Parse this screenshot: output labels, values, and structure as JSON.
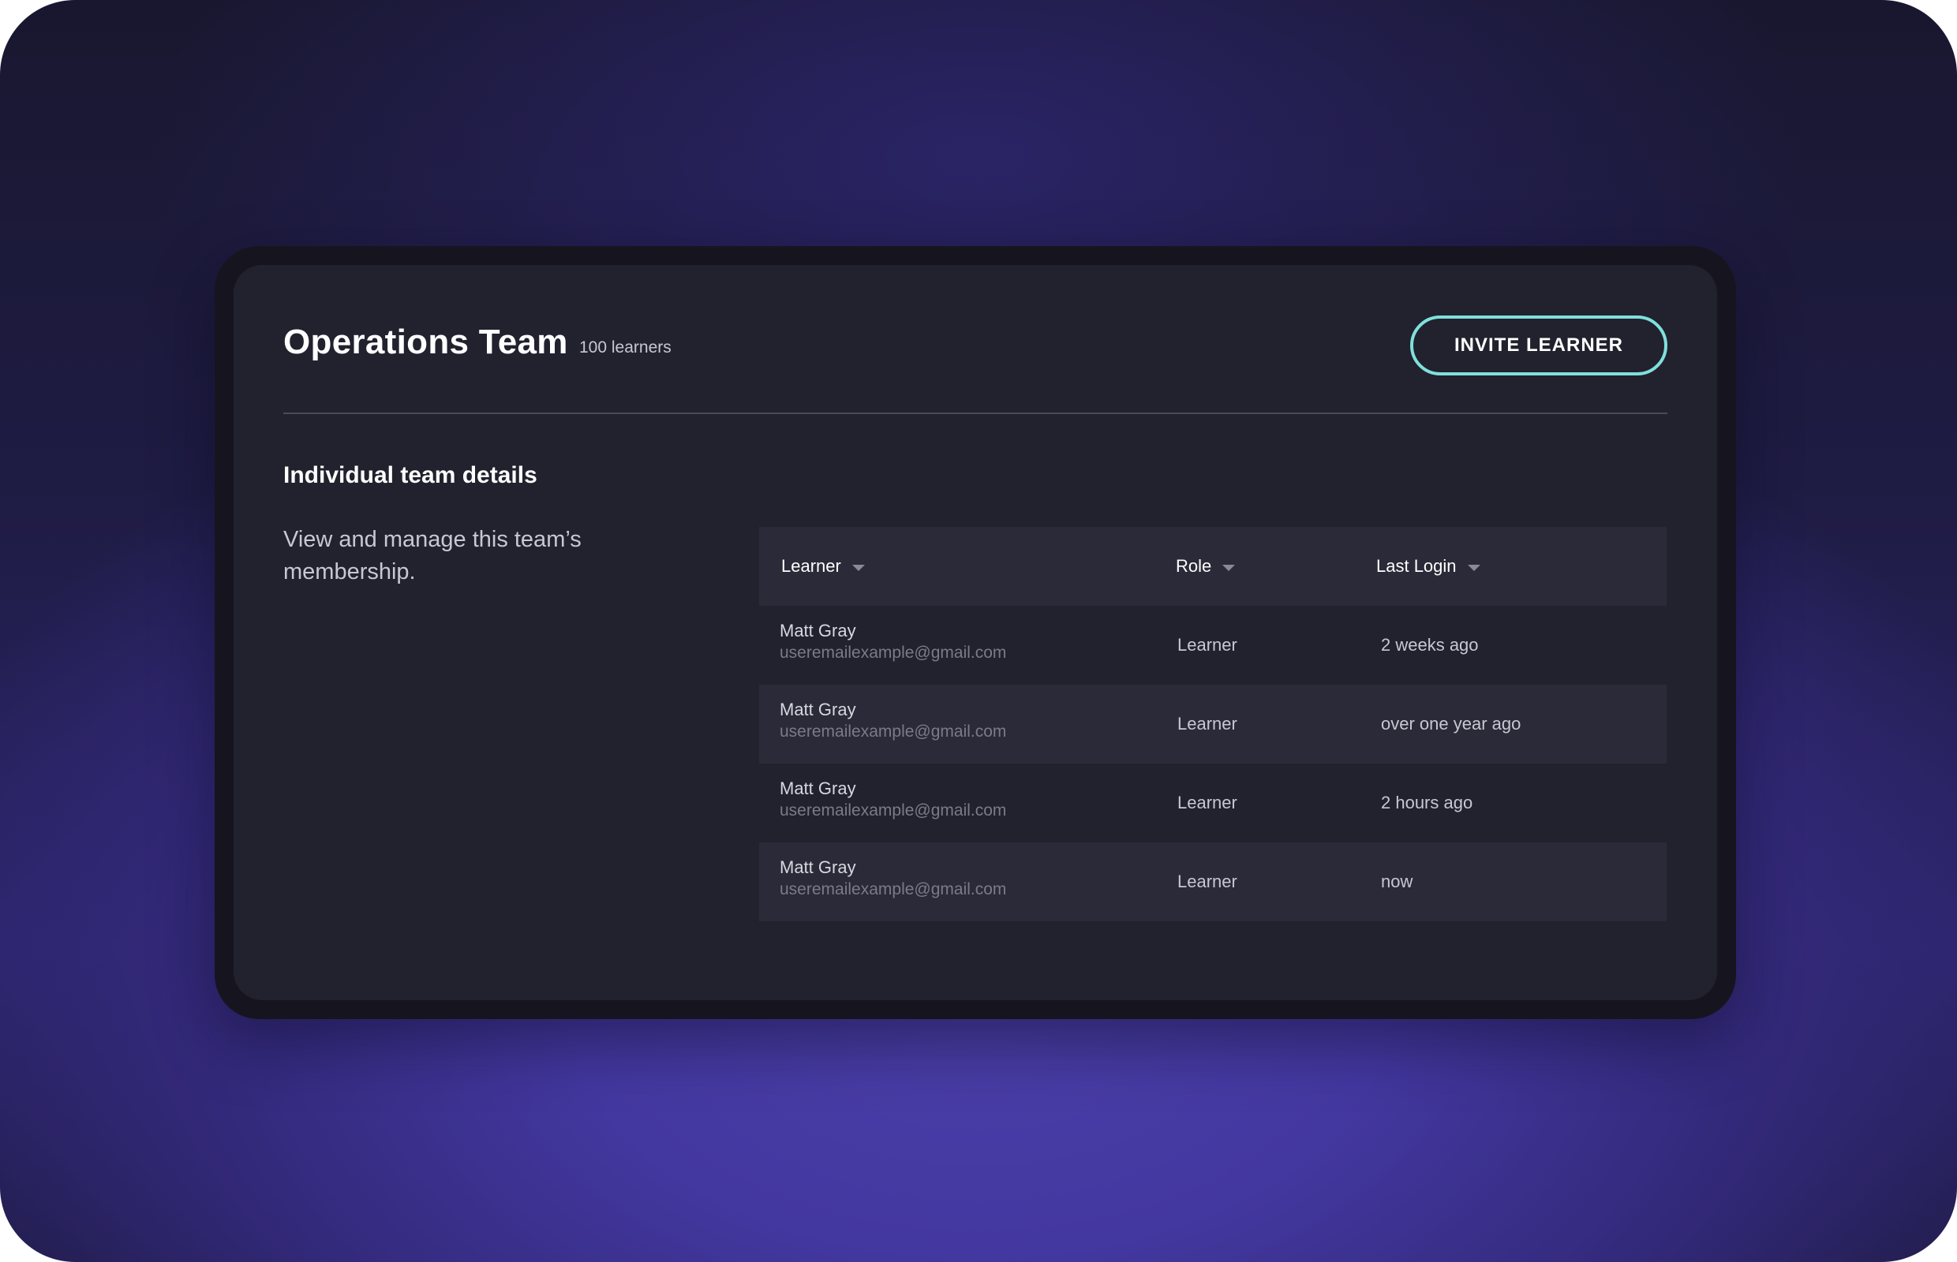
{
  "team": {
    "title": "Operations Team",
    "count": "100 learners",
    "invite_label": "INVITE LEARNER"
  },
  "section": {
    "title": "Individual team details",
    "description": "View and manage this team’s membership."
  },
  "table": {
    "columns": [
      {
        "label": "Learner"
      },
      {
        "label": "Role"
      },
      {
        "label": "Last Login"
      }
    ],
    "rows": [
      {
        "name": "Matt Gray",
        "email": "useremailexample@gmail.com",
        "role": "Learner",
        "last_login": "2 weeks ago"
      },
      {
        "name": "Matt Gray",
        "email": "useremailexample@gmail.com",
        "role": "Learner",
        "last_login": "over one year ago"
      },
      {
        "name": "Matt Gray",
        "email": "useremailexample@gmail.com",
        "role": "Learner",
        "last_login": "2 hours ago"
      },
      {
        "name": "Matt Gray",
        "email": "useremailexample@gmail.com",
        "role": "Learner",
        "last_login": "now"
      }
    ]
  },
  "colors": {
    "accent": "#7fe0dc",
    "panel": "#22212e",
    "row_alt": "#2b2a38"
  },
  "icons": {
    "sort": "chevron-down-icon"
  }
}
